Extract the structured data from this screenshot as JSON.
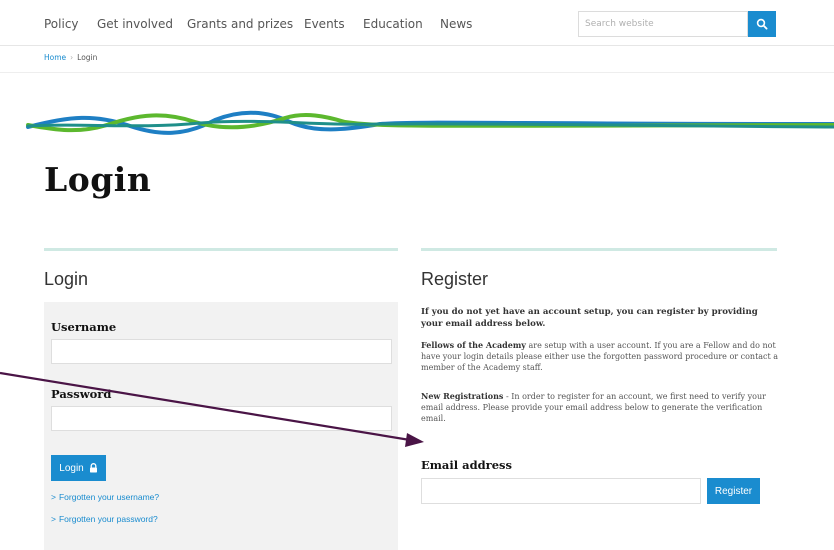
{
  "nav": {
    "items": [
      "Policy",
      "Get involved",
      "Grants and prizes",
      "Events",
      "Education",
      "News"
    ],
    "search_placeholder": "Search website",
    "search_icon": "search-icon"
  },
  "breadcrumb": {
    "home": "Home",
    "separator": "›",
    "current": "Login"
  },
  "page": {
    "title": "Login"
  },
  "login": {
    "heading": "Login",
    "username_label": "Username",
    "username_value": "",
    "password_label": "Password",
    "password_value": "",
    "button_label": "Login",
    "button_icon": "lock-icon",
    "forgot_username": "Forgotten your username?",
    "forgot_password": "Forgotten your password?"
  },
  "register": {
    "heading": "Register",
    "intro": "If you do not yet have an account setup, you can register by providing your email address below.",
    "fellows_title": "Fellows of the Academy",
    "fellows_text": " are setup with a user account. If you are a Fellow and do not have your login details please either use the forgotten password procedure or contact a member of the Academy staff.",
    "new_reg_title": "New Registrations",
    "new_reg_text": " - In order to register for an account, we first need to verify your email address. Please provide your email address below to generate the verification email.",
    "email_label": "Email address",
    "email_value": "",
    "button_label": "Register"
  },
  "colors": {
    "accent": "#1a8ccf",
    "wave_green": "#5cb82e",
    "wave_blue": "#1e7fc4",
    "wave_teal": "#1f8f8a",
    "annotation_arrow": "#4a1446",
    "panel_bg": "#f2f2f2"
  }
}
